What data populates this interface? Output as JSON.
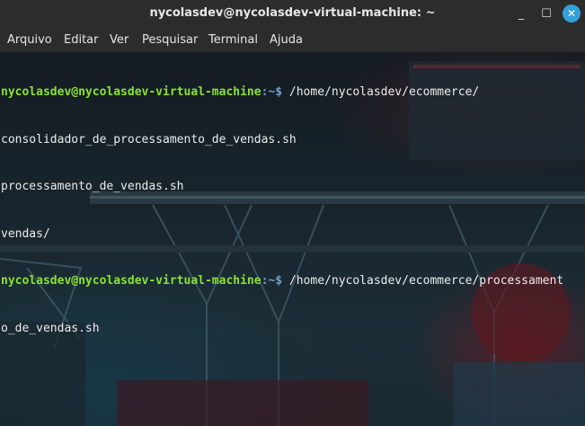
{
  "window": {
    "title": "nycolasdev@nycolasdev-virtual-machine: ~",
    "minimize_glyph": "_",
    "maximize_glyph": "☐",
    "close_glyph": "✕"
  },
  "menu": {
    "items": [
      "Arquivo",
      "Editar",
      "Ver",
      "Pesquisar",
      "Terminal",
      "Ajuda"
    ]
  },
  "terminal": {
    "line1": {
      "user": "nycolasdev@nycolasdev-virtual-machine",
      "sep": ":~$",
      "cmd": " /home/nycolasdev/ecommerce/"
    },
    "output": [
      "consolidador_de_processamento_de_vendas.sh",
      "processamento_de_vendas.sh",
      "vendas/"
    ],
    "line2": {
      "user": "nycolasdev@nycolasdev-virtual-machine",
      "sep": ":~$",
      "cmd": " /home/nycolasdev/ecommerce/processament",
      "wrap": "o_de_vendas.sh"
    }
  },
  "colors": {
    "prompt_user": "#8ae234",
    "prompt_path": "#729fcf",
    "titlebar": "#2c2c2c",
    "close_button": "#35a0d8"
  }
}
